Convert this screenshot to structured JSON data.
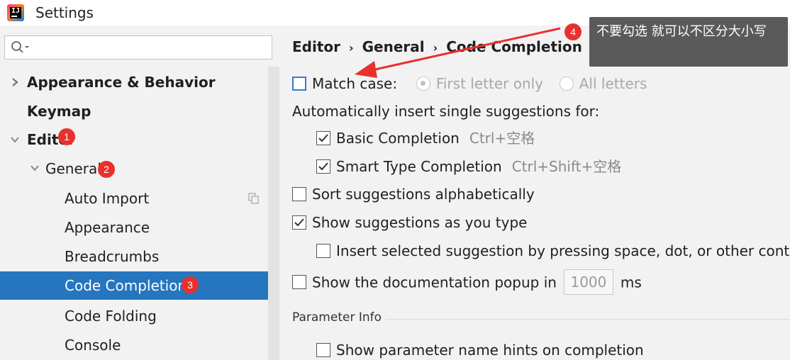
{
  "window": {
    "title": "Settings"
  },
  "search": {
    "placeholder": ""
  },
  "sidebar": {
    "items": [
      {
        "label": "Appearance & Behavior"
      },
      {
        "label": "Keymap"
      },
      {
        "label": "Editor"
      },
      {
        "label": "General"
      },
      {
        "label": "Auto Import"
      },
      {
        "label": "Appearance"
      },
      {
        "label": "Breadcrumbs"
      },
      {
        "label": "Code Completion"
      },
      {
        "label": "Code Folding"
      },
      {
        "label": "Console"
      }
    ],
    "selected": "Code Completion"
  },
  "breadcrumb": {
    "items": [
      "Editor",
      "General",
      "Code Completion"
    ],
    "separator": "›"
  },
  "options": {
    "match_case": {
      "label": "Match case:",
      "checked": false
    },
    "first_letter": {
      "label": "First letter only",
      "selected": true,
      "enabled": false
    },
    "all_letters": {
      "label": "All letters",
      "selected": false,
      "enabled": false
    },
    "auto_insert_heading": "Automatically insert single suggestions for:",
    "basic_completion": {
      "label": "Basic Completion",
      "shortcut": "Ctrl+空格",
      "checked": true
    },
    "smart_type": {
      "label": "Smart Type Completion",
      "shortcut": "Ctrl+Shift+空格",
      "checked": true
    },
    "sort_alpha": {
      "label": "Sort suggestions alphabetically",
      "checked": false
    },
    "show_as_type": {
      "label": "Show suggestions as you type",
      "checked": true
    },
    "insert_selected": {
      "label": "Insert selected suggestion by pressing space, dot, or other contex",
      "checked": false
    },
    "doc_popup": {
      "label": "Show the documentation popup in",
      "value": "1000",
      "unit": "ms",
      "checked": false
    },
    "param_section": "Parameter Info",
    "param_hints": {
      "label": "Show parameter name hints on completion",
      "checked": false
    }
  },
  "annotations": {
    "badges": [
      "1",
      "2",
      "3",
      "4"
    ],
    "tooltip": "不要勾选 就可以不区分大小写",
    "badge_color": "#e8312f",
    "arrow_color": "#e8312f"
  },
  "colors": {
    "selection": "#2675bf",
    "background": "#f2f2f2"
  }
}
